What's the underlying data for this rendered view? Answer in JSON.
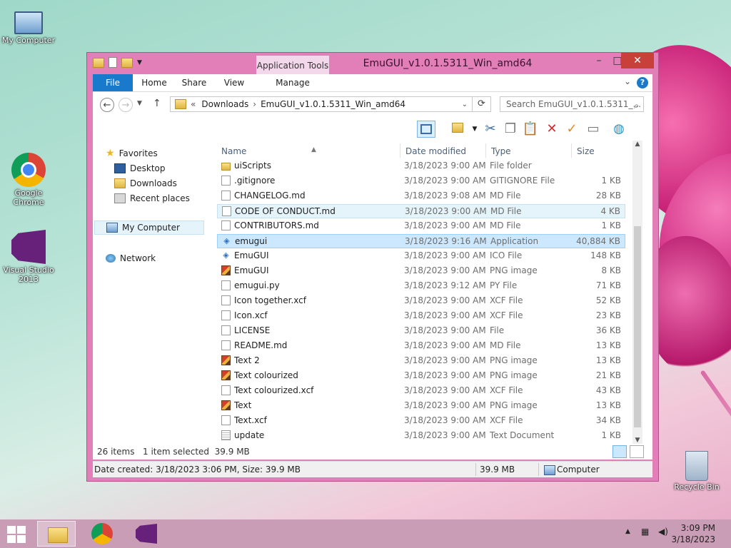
{
  "desktop": {
    "icons": [
      {
        "label": "My Computer"
      },
      {
        "label": "Google Chrome"
      },
      {
        "label": "Visual Studio 2013"
      },
      {
        "label": "Recycle Bin"
      }
    ]
  },
  "window": {
    "title": "EmuGUI_v1.0.1.5311_Win_amd64",
    "contextual_tab_group": "Application Tools",
    "ribbon_tabs": [
      "File",
      "Home",
      "Share",
      "View",
      "Manage"
    ],
    "controls": {
      "minimize": "–",
      "maximize": "□",
      "close": "✕"
    }
  },
  "address": {
    "prefix": "«",
    "crumbs": [
      "Downloads",
      "EmuGUI_v1.0.1.5311_Win_amd64"
    ],
    "search_placeholder": "Search EmuGUI_v1.0.1.5311_..."
  },
  "nav": {
    "favorites": "Favorites",
    "desktop": "Desktop",
    "downloads": "Downloads",
    "recent": "Recent places",
    "computer": "My Computer",
    "network": "Network"
  },
  "columns": {
    "name": "Name",
    "date": "Date modified",
    "type": "Type",
    "size": "Size"
  },
  "files": [
    {
      "name": "uiScripts",
      "date": "3/18/2023 9:00 AM",
      "type": "File folder",
      "size": "",
      "icon": "folder"
    },
    {
      "name": ".gitignore",
      "date": "3/18/2023 9:00 AM",
      "type": "GITIGNORE File",
      "size": "1 KB",
      "icon": "file"
    },
    {
      "name": "CHANGELOG.md",
      "date": "3/18/2023 9:08 AM",
      "type": "MD File",
      "size": "28 KB",
      "icon": "file"
    },
    {
      "name": "CODE OF CONDUCT.md",
      "date": "3/18/2023 9:00 AM",
      "type": "MD File",
      "size": "4 KB",
      "icon": "file"
    },
    {
      "name": "CONTRIBUTORS.md",
      "date": "3/18/2023 9:00 AM",
      "type": "MD File",
      "size": "1 KB",
      "icon": "file"
    },
    {
      "name": "emugui",
      "date": "3/18/2023 9:16 AM",
      "type": "Application",
      "size": "40,884 KB",
      "icon": "app"
    },
    {
      "name": "EmuGUI",
      "date": "3/18/2023 9:00 AM",
      "type": "ICO File",
      "size": "148 KB",
      "icon": "app"
    },
    {
      "name": "EmuGUI",
      "date": "3/18/2023 9:00 AM",
      "type": "PNG image",
      "size": "8 KB",
      "icon": "png"
    },
    {
      "name": "emugui.py",
      "date": "3/18/2023 9:12 AM",
      "type": "PY File",
      "size": "71 KB",
      "icon": "file"
    },
    {
      "name": "Icon together.xcf",
      "date": "3/18/2023 9:00 AM",
      "type": "XCF File",
      "size": "52 KB",
      "icon": "file"
    },
    {
      "name": "Icon.xcf",
      "date": "3/18/2023 9:00 AM",
      "type": "XCF File",
      "size": "23 KB",
      "icon": "file"
    },
    {
      "name": "LICENSE",
      "date": "3/18/2023 9:00 AM",
      "type": "File",
      "size": "36 KB",
      "icon": "file"
    },
    {
      "name": "README.md",
      "date": "3/18/2023 9:00 AM",
      "type": "MD File",
      "size": "13 KB",
      "icon": "file"
    },
    {
      "name": "Text 2",
      "date": "3/18/2023 9:00 AM",
      "type": "PNG image",
      "size": "13 KB",
      "icon": "png"
    },
    {
      "name": "Text colourized",
      "date": "3/18/2023 9:00 AM",
      "type": "PNG image",
      "size": "21 KB",
      "icon": "png"
    },
    {
      "name": "Text colourized.xcf",
      "date": "3/18/2023 9:00 AM",
      "type": "XCF File",
      "size": "43 KB",
      "icon": "file"
    },
    {
      "name": "Text",
      "date": "3/18/2023 9:00 AM",
      "type": "PNG image",
      "size": "13 KB",
      "icon": "png"
    },
    {
      "name": "Text.xcf",
      "date": "3/18/2023 9:00 AM",
      "type": "XCF File",
      "size": "34 KB",
      "icon": "file"
    },
    {
      "name": "update",
      "date": "3/18/2023 9:00 AM",
      "type": "Text Document",
      "size": "1 KB",
      "icon": "text"
    }
  ],
  "status": {
    "items": "26 items",
    "selected": "1 item selected  39.9 MB"
  },
  "details": {
    "info": "Date created: 3/18/2023 3:06 PM, Size: 39.9 MB",
    "size": "39.9 MB",
    "location": "Computer"
  },
  "taskbar": {
    "time": "3:09 PM",
    "date": "3/18/2023"
  }
}
